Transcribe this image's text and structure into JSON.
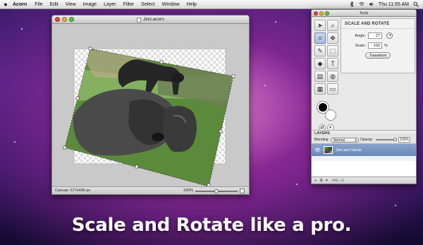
{
  "menubar": {
    "app_name": "Acorn",
    "items": [
      "File",
      "Edit",
      "View",
      "Image",
      "Layer",
      "Filter",
      "Select",
      "Window",
      "Help"
    ],
    "clock": "Thu 11:55 AM"
  },
  "document": {
    "title": "Jimi.acorn",
    "status": "Canvas: 677x495 px",
    "zoom": "100%",
    "zoom_level": 0.5
  },
  "tools": {
    "title": "Tools",
    "icons": [
      "arrow-tool",
      "magnifier-tool",
      "crop-tool",
      "move-tool",
      "brush-tool",
      "marquee-tool",
      "eraser-tool",
      "text-tool",
      "gradient-tool",
      "fill-tool",
      "layer-tool",
      "shape-tool"
    ],
    "inspector": {
      "title": "SCALE AND ROTATE",
      "angle_label": "Angle:",
      "angle_value": "27",
      "scale_label": "Scale:",
      "scale_value": "100",
      "scale_unit": "%",
      "transform_button": "Transform"
    },
    "layers": {
      "header": "LAYERS",
      "blending_label": "Blending:",
      "blending_value": "Normal",
      "opacity_label": "Opacity:",
      "opacity_value": "100%",
      "opacity_level": 1.0,
      "layer_name": "Jimi and Stevie",
      "footer_dims": "44E,-13"
    }
  },
  "caption": "Scale and Rotate like a pro."
}
